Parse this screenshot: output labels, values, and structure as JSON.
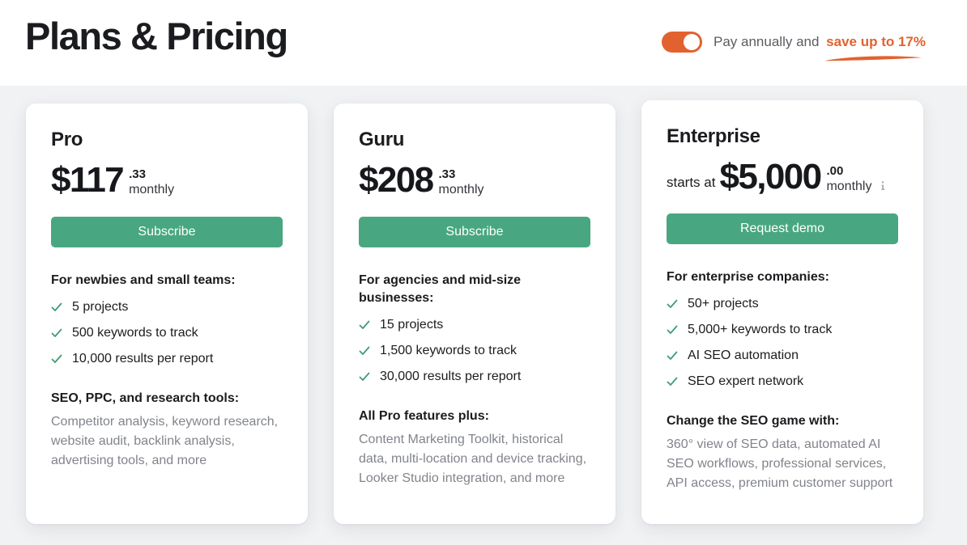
{
  "header": {
    "title": "Plans & Pricing",
    "billing": {
      "toggle_state": "on",
      "toggle_name": "annual-billing-toggle",
      "label": "Pay annually and",
      "save_text": "save up to 17%",
      "accent_color": "#e2622f"
    }
  },
  "colors": {
    "page_background": "#f1f2f4",
    "card_background": "#ffffff",
    "cta_green": "#48a781",
    "accent_orange": "#e2622f",
    "text_primary": "#1b1c1f",
    "text_muted": "#81848b",
    "check_green": "#3f9d73"
  },
  "plans": [
    {
      "id": "pro",
      "name": "Pro",
      "price_prefix": "",
      "price_main": "$117",
      "price_cents": ".33",
      "price_period": "monthly",
      "has_info_icon": false,
      "cta_label": "Subscribe",
      "feature_heading": "For newbies and small teams:",
      "features": [
        "5 projects",
        "500 keywords to track",
        "10,000 results per report"
      ],
      "detail_heading": "SEO, PPC, and research tools:",
      "detail_text": "Competitor analysis, keyword research, website audit, backlink analysis, advertising tools, and more"
    },
    {
      "id": "guru",
      "name": "Guru",
      "price_prefix": "",
      "price_main": "$208",
      "price_cents": ".33",
      "price_period": "monthly",
      "has_info_icon": false,
      "cta_label": "Subscribe",
      "feature_heading": "For agencies and mid-size businesses:",
      "features": [
        "15 projects",
        "1,500 keywords to track",
        "30,000 results per report"
      ],
      "detail_heading": "All Pro features plus:",
      "detail_text": "Content Marketing Toolkit, historical data, multi-location and device tracking, Looker Studio integration, and more"
    },
    {
      "id": "enterprise",
      "name": "Enterprise",
      "price_prefix": "starts at",
      "price_main": "$5,000",
      "price_cents": ".00",
      "price_period": "monthly",
      "has_info_icon": true,
      "cta_label": "Request demo",
      "feature_heading": "For enterprise companies:",
      "features": [
        "50+ projects",
        "5,000+ keywords to track",
        "AI SEO automation",
        "SEO expert network"
      ],
      "detail_heading": "Change the SEO game with:",
      "detail_text": "360° view of SEO data, automated AI SEO workflows, professional services, API access, premium customer support"
    }
  ]
}
